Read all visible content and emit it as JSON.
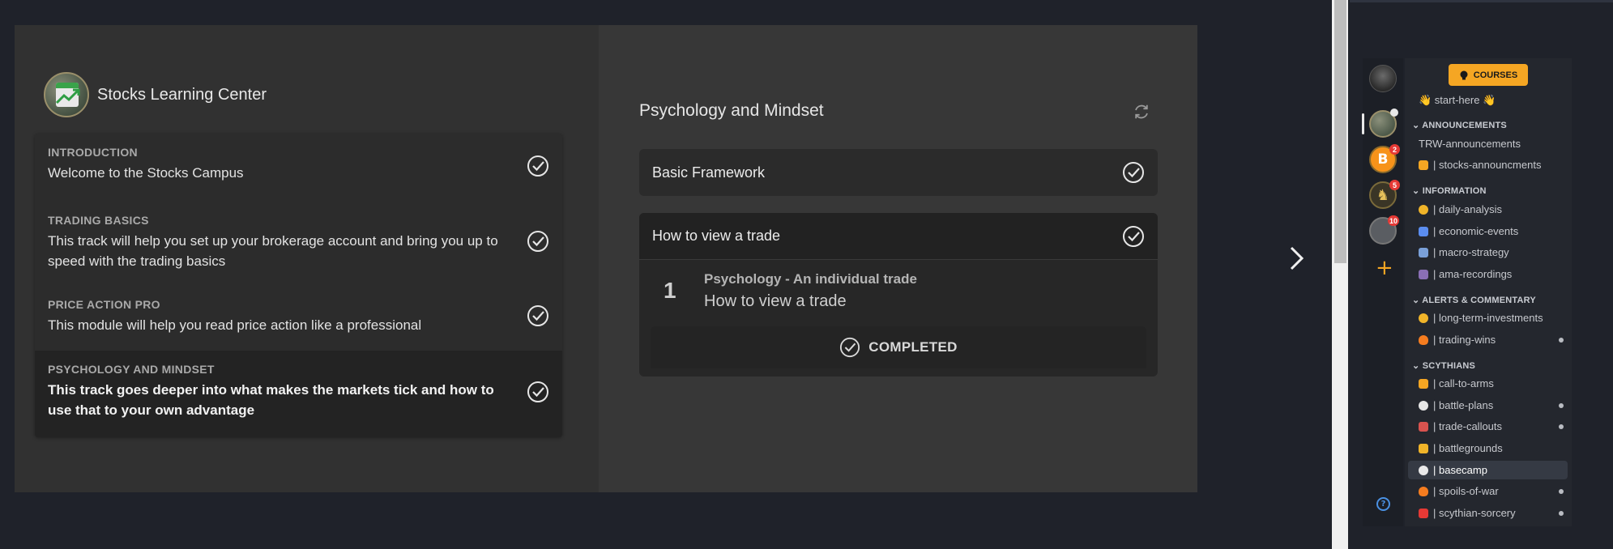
{
  "course": {
    "brand_title": "Stocks Learning Center",
    "modules": [
      {
        "heading": "INTRODUCTION",
        "description": "Welcome to the Stocks Campus"
      },
      {
        "heading": "TRADING BASICS",
        "description": "This track will help you set up your brokerage account and bring you up to speed with the trading basics"
      },
      {
        "heading": "PRICE ACTION PRO",
        "description": "This module will help you read price action like a professional"
      },
      {
        "heading": "PSYCHOLOGY AND MINDSET",
        "description": "This track goes deeper into what makes the markets tick and how to use that to your own advantage"
      }
    ],
    "section_title": "Psychology and Mindset",
    "cards": [
      {
        "label": "Basic Framework"
      },
      {
        "label": "How to view a trade"
      }
    ],
    "lesson": {
      "number": "1",
      "title": "Psychology - An individual trade",
      "subtitle": "How to view a trade",
      "status": "COMPLETED"
    }
  },
  "sidebar": {
    "courses_label": "COURSES",
    "servers": [
      {
        "icon": "user-avatar"
      },
      {
        "icon": "stocks-server-icon",
        "badge": ""
      },
      {
        "icon": "bitcoin-server-icon",
        "glyph": "B",
        "badge": "2"
      },
      {
        "icon": "chess-knight-server-icon",
        "glyph": "♞",
        "badge": "5"
      },
      {
        "icon": "misc-server-icon",
        "badge": "10"
      }
    ],
    "add_glyph": "+",
    "help_glyph": "?",
    "top_channel": "👋 start-here 👋",
    "categories": [
      {
        "name": "ANNOUNCEMENTS",
        "channels": [
          {
            "name": "TRW-announcements",
            "emoji": ""
          },
          {
            "name": "| stocks-announcments",
            "emoji": "#f5a623"
          }
        ]
      },
      {
        "name": "INFORMATION",
        "channels": [
          {
            "name": "| daily-analysis",
            "emoji": "#f0b429"
          },
          {
            "name": "| economic-events",
            "emoji": "#5b8def"
          },
          {
            "name": "| macro-strategy",
            "emoji": "#7aa0d8"
          },
          {
            "name": "| ama-recordings",
            "emoji": "#8a6fb5"
          }
        ]
      },
      {
        "name": "ALERTS & COMMENTARY",
        "channels": [
          {
            "name": "| long-term-investments",
            "emoji": "#f0b429",
            "unread": true
          },
          {
            "name": "| trading-wins",
            "emoji": "#f57c1f",
            "unread": true
          }
        ]
      },
      {
        "name": "SCYTHIANS",
        "channels": [
          {
            "name": "| call-to-arms",
            "emoji": "#f5a623"
          },
          {
            "name": "| battle-plans",
            "emoji": "#e6e6e6",
            "unread": true
          },
          {
            "name": "| trade-callouts",
            "emoji": "#d9534f",
            "unread": true
          },
          {
            "name": "| battlegrounds",
            "emoji": "#f0b429"
          },
          {
            "name": "| basecamp",
            "emoji": "#e9e9e9",
            "selected": true
          },
          {
            "name": "| spoils-of-war",
            "emoji": "#f57c1f",
            "unread": true
          },
          {
            "name": "| scythian-sorcery",
            "emoji": "#e53935",
            "unread": true
          }
        ]
      }
    ]
  },
  "colors": {
    "accent": "#f5a623",
    "badge": "#e53935",
    "help": "#4a90e2",
    "panel_left": "#313131",
    "panel_right": "#373737",
    "background": "#1f222a"
  }
}
